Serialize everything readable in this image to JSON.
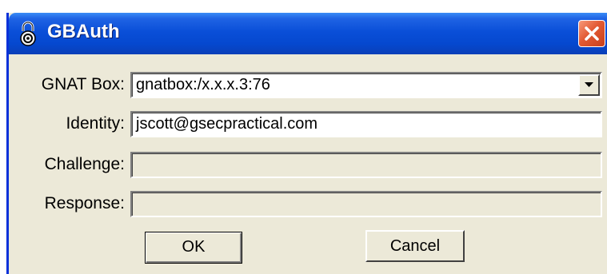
{
  "window": {
    "title": "GBAuth",
    "title_icon": "padlock-icon",
    "close_icon": "close-icon"
  },
  "form": {
    "gnat_box": {
      "label": "GNAT Box:",
      "value": "gnatbox:/x.x.x.3:76",
      "icon": "chevron-down-icon"
    },
    "identity": {
      "label": "Identity:",
      "value": "jscott@gsecpractical.com"
    },
    "challenge": {
      "label": "Challenge:",
      "value": ""
    },
    "response": {
      "label": "Response:",
      "value": ""
    }
  },
  "buttons": {
    "ok_label": "OK",
    "cancel_label": "Cancel"
  },
  "colors": {
    "titlebar": "#0548cf",
    "dialog_bg": "#ece9d8",
    "close_button": "#e25a33"
  }
}
